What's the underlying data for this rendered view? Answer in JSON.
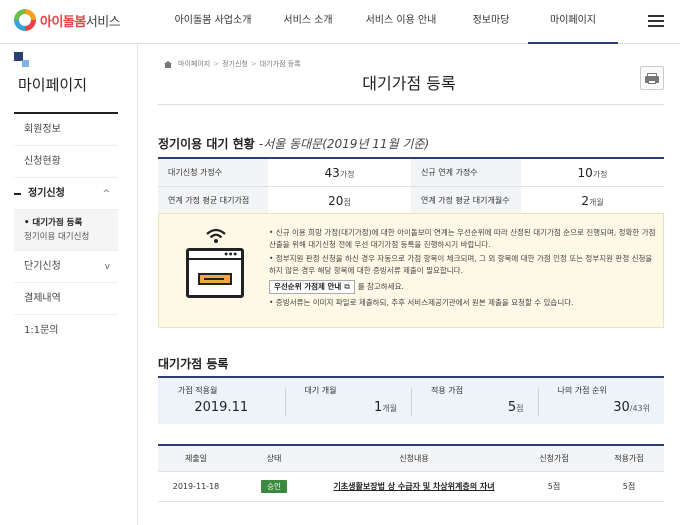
{
  "header": {
    "logo_main": "아이돌봄",
    "logo_sub": "서비스",
    "nav": [
      {
        "label": "아이돌봄 사업소개"
      },
      {
        "label": "서비스 소개"
      },
      {
        "label": "서비스 이용 안내"
      },
      {
        "label": "정보마당"
      },
      {
        "label": "마이페이지"
      }
    ]
  },
  "sidebar": {
    "title": "마이페이지",
    "items": [
      {
        "label": "회원정보"
      },
      {
        "label": "신청현황"
      },
      {
        "label": "정기신청",
        "chevron": "^"
      },
      {
        "label": "단기신청",
        "chevron": "v"
      },
      {
        "label": "결제내역"
      },
      {
        "label": "1:1문의"
      }
    ],
    "sub_items": [
      {
        "label": "• 대기가점 등록"
      },
      {
        "label": "정기이용 대기신청"
      }
    ]
  },
  "breadcrumb": [
    "마이페이지",
    "정기신청",
    "대기가점 등록"
  ],
  "page_title": "대기가점 등록",
  "status": {
    "title": "정기이용 대기 현황",
    "subtitle": "-서울 동대문(2019년 11월 기준)",
    "rows": [
      [
        {
          "label": "대기신청 가정수",
          "value": "43",
          "unit": "가정"
        },
        {
          "label": "신규 연계 가정수",
          "value": "10",
          "unit": "가정"
        }
      ],
      [
        {
          "label": "연계 가정 평균 대기가점",
          "value": "20",
          "unit": "점"
        },
        {
          "label": "연계 가정 평균 대기개월수",
          "value": "2",
          "unit": "개월"
        }
      ]
    ]
  },
  "notice": {
    "line1": "• 신규 이용 희망 가정(대기가정)에 대한 아이돌보미 연계는 우선순위에 따라 산정된 대기가점 순으로 진행되며, 정확한 가점 산출을 위해 대기신청 전에 우선 대기가점 등록을 진행하시기 바랍니다.",
    "line2": "• 정부지원 판정 신청을 하신 경우 자동으로 가점 항목이 체크되며, 그 외 항목에 대한 가점 인정 또는 정부지원 판정 신청을 하지 않은 경우 해당 항목에 대한 증빙서류 제출이 필요합니다.",
    "button_label": "우선순위 가점제 안내",
    "button_suffix": "를 참고하세요.",
    "line3": "• 증빙서류는 이미지 파일로 제출하되, 추후 서비스제공기관에서 원본 제출을 요청할 수 있습니다."
  },
  "registration": {
    "title": "대기가점 등록",
    "cells": [
      {
        "label": "가점 적용월",
        "value": "2019.11",
        "unit": ""
      },
      {
        "label": "대기 개월",
        "value": "1",
        "unit": "개월"
      },
      {
        "label": "적용 가점",
        "value": "5",
        "unit": "점"
      },
      {
        "label": "나의 가점 순위",
        "value": "30",
        "unit": "/43위"
      }
    ]
  },
  "table": {
    "headers": [
      "제출일",
      "상태",
      "신청내용",
      "신청가점",
      "적용가점"
    ],
    "rows": [
      {
        "date": "2019-11-18",
        "status": "승인",
        "content": "기초생활보장법 상 수급자 및 차상위계층의 자녀",
        "applied": "5점",
        "granted": "5점"
      }
    ]
  },
  "colors": {
    "accent": "#2b3f72",
    "approved": "#3c8a3f",
    "notice_bg": "#fdf9e6"
  }
}
